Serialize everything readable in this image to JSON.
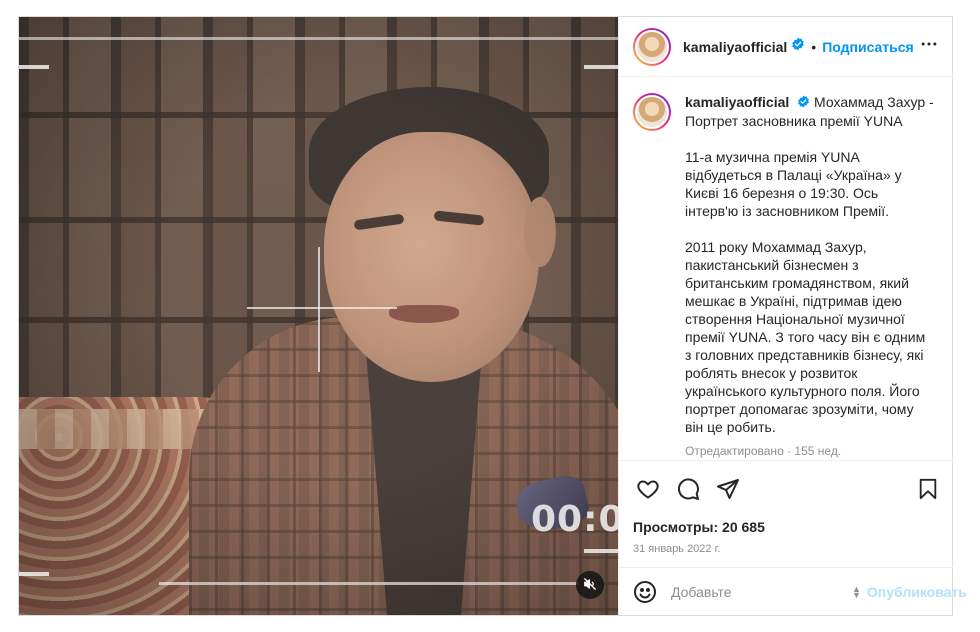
{
  "post": {
    "author": "kamaliyaofficial",
    "follow_label": "Подписаться",
    "separator": "•",
    "more_icon": "more-horizontal-icon",
    "verified_icon": "verified-badge-icon"
  },
  "media": {
    "timecode": "00:0",
    "mute_icon": "speaker-muted-icon"
  },
  "caption": {
    "author": "kamaliyaofficial",
    "title": " Мохаммад Захур - Портрет засновника премії YUNA",
    "paragraph1": "11-а музична премія YUNA відбудеться в Палаці «Україна» у Києві 16 березня о 19:30. Ось інтерв'ю із засновником Премії.",
    "paragraph2": "2011 року Мохаммад Захур, пакистанський бізнесмен з британським громадянством, який мешкає в Україні, підтримав ідею створення Національної музичної премії YUNA. З того часу він є одним з головних представників бізнесу, які роблять внесок у розвиток українського культурного поля. Його портрет допомагає зрозуміти, чому він це робить.",
    "edited": "Отредактировано",
    "age": "155 нед."
  },
  "actions": {
    "like_icon": "heart-icon",
    "comment_icon": "comment-bubble-icon",
    "share_icon": "paper-plane-icon",
    "save_icon": "bookmark-icon",
    "views": "Просмотры: 20 685",
    "date": "31 январь 2022 г."
  },
  "comment_box": {
    "emoji_icon": "smiley-icon",
    "placeholder": "Добавьте",
    "publish_label": "Опубликовать"
  },
  "colors": {
    "accent": "#0095f6",
    "publish_disabled": "#b2dffc",
    "muted_text": "#8e8e8e",
    "border": "#dbdbdb"
  }
}
